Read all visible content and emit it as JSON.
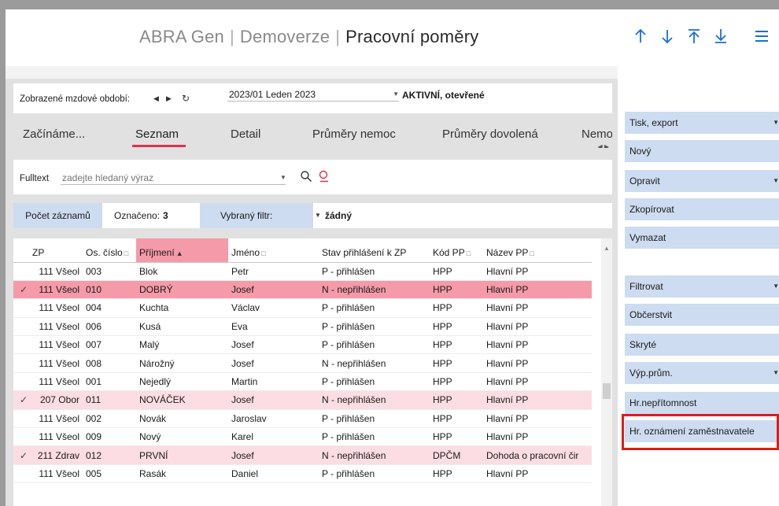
{
  "header": {
    "app": "ABRA Gen",
    "edition": "Demoverze",
    "module": "Pracovní poměry",
    "nav_icons": [
      "arrow-up-icon",
      "arrow-down-icon",
      "arrow-to-top-icon",
      "arrow-to-bottom-icon",
      "hamburger-menu-icon"
    ]
  },
  "period": {
    "label": "Zobrazené mzdové období:",
    "value": "2023/01 Leden 2023",
    "status": "AKTIVNÍ, otevřené"
  },
  "tabs": [
    {
      "label": "Začínáme..."
    },
    {
      "label": "Seznam",
      "active": true
    },
    {
      "label": "Detail"
    },
    {
      "label": "Průměry nemoc"
    },
    {
      "label": "Průměry dovolená"
    },
    {
      "label": "Nemoce"
    }
  ],
  "fulltext": {
    "label": "Fulltext",
    "placeholder": "zadejte hledaný výraz"
  },
  "counts": {
    "count_button": "Počet záznamů",
    "marked_label": "Označeno:",
    "marked_value": "3",
    "filter_label": "Vybraný filtr:",
    "filter_value": "žádný"
  },
  "table": {
    "columns": [
      "ZP",
      "Os. číslo",
      "Příjmení",
      "Jméno",
      "Stav přihlášení k ZP",
      "Kód PP",
      "Název PP"
    ],
    "rows": [
      {
        "check": "",
        "zp": "111 Všeol",
        "os": "003",
        "prijmeni": "Blok",
        "jmeno": "Petr",
        "stav": "P - přihlášen",
        "kod": "HPP",
        "nazev": "Hlavní PP",
        "state": "normal"
      },
      {
        "check": "✓",
        "zp": "111 Všeol",
        "os": "010",
        "prijmeni": "DOBRÝ",
        "jmeno": "Josef",
        "stav": "N - nepřihlášen",
        "kod": "HPP",
        "nazev": "Hlavní PP",
        "state": "selected"
      },
      {
        "check": "",
        "zp": "111 Všeol",
        "os": "004",
        "prijmeni": "Kuchta",
        "jmeno": "Václav",
        "stav": "P - přihlášen",
        "kod": "HPP",
        "nazev": "Hlavní PP",
        "state": "normal"
      },
      {
        "check": "",
        "zp": "111 Všeol",
        "os": "006",
        "prijmeni": "Kusá",
        "jmeno": "Eva",
        "stav": "P - přihlášen",
        "kod": "HPP",
        "nazev": "Hlavní PP",
        "state": "normal"
      },
      {
        "check": "",
        "zp": "111 Všeol",
        "os": "007",
        "prijmeni": "Malý",
        "jmeno": "Josef",
        "stav": "P - přihlášen",
        "kod": "HPP",
        "nazev": "Hlavní PP",
        "state": "normal"
      },
      {
        "check": "",
        "zp": "111 Všeol",
        "os": "008",
        "prijmeni": "Nárožný",
        "jmeno": "Josef",
        "stav": "N - nepřihlášen",
        "kod": "HPP",
        "nazev": "Hlavní PP",
        "state": "normal"
      },
      {
        "check": "",
        "zp": "111 Všeol",
        "os": "001",
        "prijmeni": "Nejedlý",
        "jmeno": "Martin",
        "stav": "P - přihlášen",
        "kod": "HPP",
        "nazev": "Hlavní PP",
        "state": "normal"
      },
      {
        "check": "✓",
        "zp": "207 Obor",
        "os": "011",
        "prijmeni": "NOVÁČEK",
        "jmeno": "Josef",
        "stav": "N - nepřihlášen",
        "kod": "HPP",
        "nazev": "Hlavní PP",
        "state": "marked"
      },
      {
        "check": "",
        "zp": "111 Všeol",
        "os": "002",
        "prijmeni": "Novák",
        "jmeno": "Jaroslav",
        "stav": "P - přihlášen",
        "kod": "HPP",
        "nazev": "Hlavní PP",
        "state": "normal"
      },
      {
        "check": "",
        "zp": "111 Všeol",
        "os": "009",
        "prijmeni": "Nový",
        "jmeno": "Karel",
        "stav": "P - přihlášen",
        "kod": "HPP",
        "nazev": "Hlavní PP",
        "state": "normal"
      },
      {
        "check": "✓",
        "zp": "211 Zdrav",
        "os": "012",
        "prijmeni": "PRVNÍ",
        "jmeno": "Josef",
        "stav": "N - nepřihlášen",
        "kod": "DPČM",
        "nazev": "Dohoda o pracovní čir",
        "state": "marked"
      },
      {
        "check": "",
        "zp": "111 Všeol",
        "os": "005",
        "prijmeni": "Rasák",
        "jmeno": "Daniel",
        "stav": "P - přihlášen",
        "kod": "HPP",
        "nazev": "Hlavní PP",
        "state": "normal"
      }
    ]
  },
  "actions": [
    {
      "label": "Tisk, export",
      "dropdown": true
    },
    {
      "label": "Nový",
      "dropdown": false
    },
    {
      "label": "Opravit",
      "dropdown": true
    },
    {
      "label": "Zkopírovat",
      "dropdown": false
    },
    {
      "label": "Vymazat",
      "dropdown": false
    },
    {
      "label": "Filtrovat",
      "dropdown": true
    },
    {
      "label": "Občerstvit",
      "dropdown": false
    },
    {
      "label": "Skryté",
      "dropdown": false
    },
    {
      "label": "Výp.prům.",
      "dropdown": true
    },
    {
      "label": "Hr.nepřítomnost",
      "dropdown": false
    },
    {
      "label": "Hr. oznámení zaměstnavatele",
      "dropdown": false
    }
  ],
  "colors": {
    "accent": "#1a6fd8",
    "selected_row": "#f59aa9",
    "marked_row": "#fbdde3",
    "button_bg": "#cddcf0",
    "highlight": "#e01b1b"
  }
}
